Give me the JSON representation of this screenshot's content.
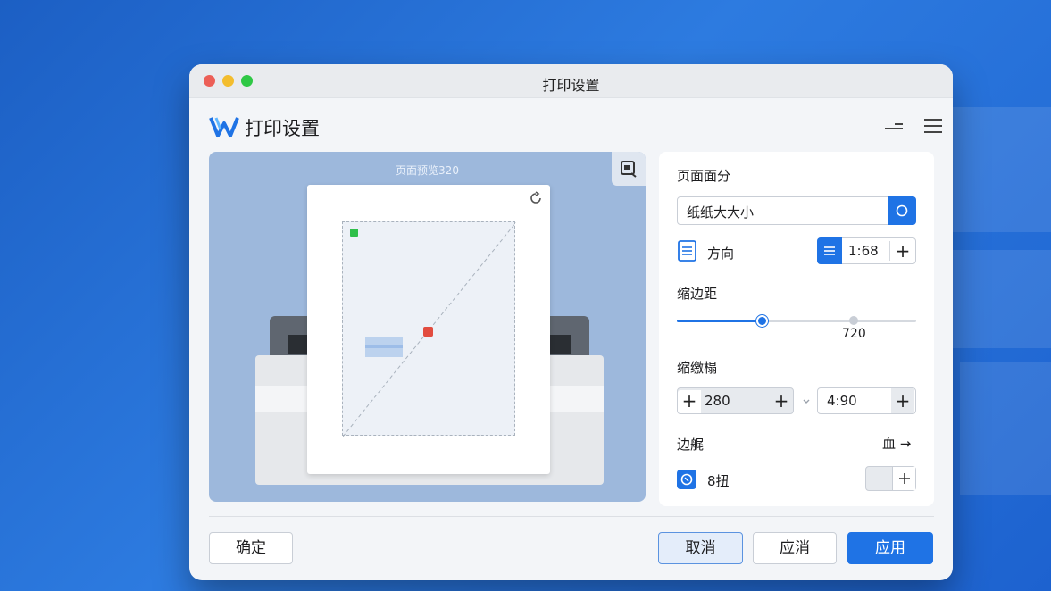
{
  "window": {
    "title": "打印设置"
  },
  "header": {
    "app_title": "打印设置"
  },
  "preview": {
    "label": "页面预览320"
  },
  "sidebar": {
    "section1_label": "页面面分",
    "paper_size_value": "纸纸大大小",
    "orientation_label": "方向",
    "orientation_value": "1:68",
    "margins_label": "缩边距",
    "margins_slider_value": "720",
    "margins_slider_fraction": 0.36,
    "scale_label": "缩缴榻",
    "scale_left_value": "280",
    "scale_right_value": "4:90",
    "border_label": "边艉",
    "border_action": "血",
    "option_label": "8扭"
  },
  "footer": {
    "confirm_label": "确定",
    "cancel_label": "取消",
    "apply_secondary_label": "应消",
    "apply_label": "应用"
  },
  "colors": {
    "accent": "#1f73e5",
    "close": "#ec5f57",
    "minimize": "#f3bd2e",
    "zoom": "#2fc845"
  }
}
